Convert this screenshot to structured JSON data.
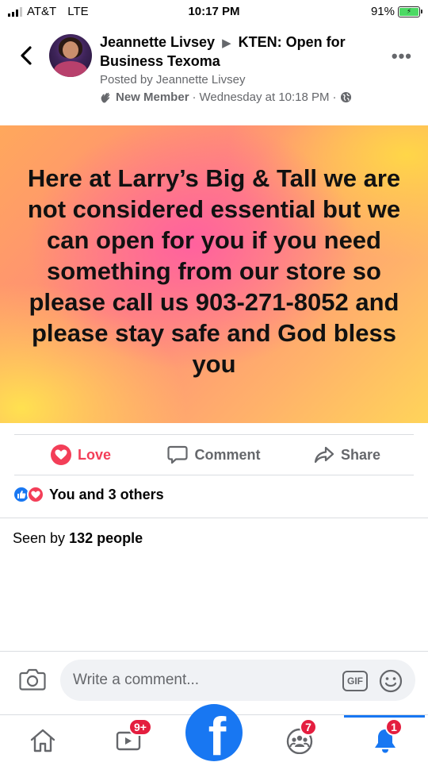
{
  "status_bar": {
    "carrier": "AT&T",
    "network": "LTE",
    "time": "10:17 PM",
    "battery": "91%"
  },
  "post": {
    "author": "Jeannette Livsey",
    "group": "KTEN: Open for Business Texoma",
    "posted_by": "Posted by Jeannette Livsey",
    "member_badge": "New Member",
    "timestamp": "Wednesday at 10:18 PM",
    "text": "Here at Larry’s Big & Tall we are not considered essential but we can open for you if you need something from our store so please call us 903-271-8052 and please stay safe and God bless you"
  },
  "actions": {
    "love": "Love",
    "comment": "Comment",
    "share": "Share"
  },
  "reactions": {
    "summary": "You and 3 others"
  },
  "seen": {
    "prefix": "Seen by",
    "count_text": "132 people"
  },
  "comment_bar": {
    "placeholder": "Write a comment...",
    "gif_label": "GIF"
  },
  "tab_bar": {
    "video_badge": "9+",
    "groups_badge": "7",
    "notifications_badge": "1",
    "logo_letter": "f"
  },
  "colors": {
    "brand_blue": "#1877f2",
    "love_red": "#f33e58",
    "badge_red": "#e41e3f",
    "muted_text": "#65676b"
  }
}
